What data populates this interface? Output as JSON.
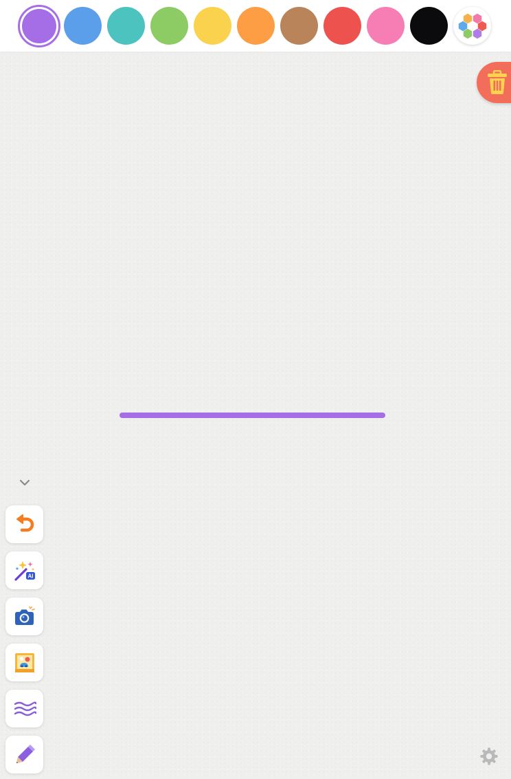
{
  "palette": {
    "swatches": [
      {
        "name": "purple",
        "color": "#a56ee6",
        "selected": true
      },
      {
        "name": "blue",
        "color": "#5b9ee9",
        "selected": false
      },
      {
        "name": "teal",
        "color": "#4cc3be",
        "selected": false
      },
      {
        "name": "green",
        "color": "#8dcb65",
        "selected": false
      },
      {
        "name": "yellow",
        "color": "#fad24d",
        "selected": false
      },
      {
        "name": "orange",
        "color": "#fd9d44",
        "selected": false
      },
      {
        "name": "brown",
        "color": "#b98459",
        "selected": false
      },
      {
        "name": "red",
        "color": "#ee524f",
        "selected": false
      },
      {
        "name": "pink",
        "color": "#f77eb4",
        "selected": false
      },
      {
        "name": "black",
        "color": "#0b0b0d",
        "selected": false
      }
    ],
    "more_colors_icon": "color-palette-icon"
  },
  "canvas": {
    "background": "#efefed",
    "stroke_color": "#a56ee6"
  },
  "trash": {
    "icon": "trash-icon",
    "color": "#f26e5a"
  },
  "toolbar": {
    "collapse_icon": "chevron-down-icon",
    "tools": [
      {
        "name": "undo",
        "icon": "undo-icon"
      },
      {
        "name": "ai-magic",
        "icon": "ai-sparkle-icon",
        "badge": "AI"
      },
      {
        "name": "camera",
        "icon": "camera-icon"
      },
      {
        "name": "image-gallery",
        "icon": "picture-icon"
      },
      {
        "name": "brush-style",
        "icon": "wave-lines-icon"
      },
      {
        "name": "pen",
        "icon": "pen-icon"
      }
    ]
  },
  "settings": {
    "icon": "gear-icon"
  }
}
